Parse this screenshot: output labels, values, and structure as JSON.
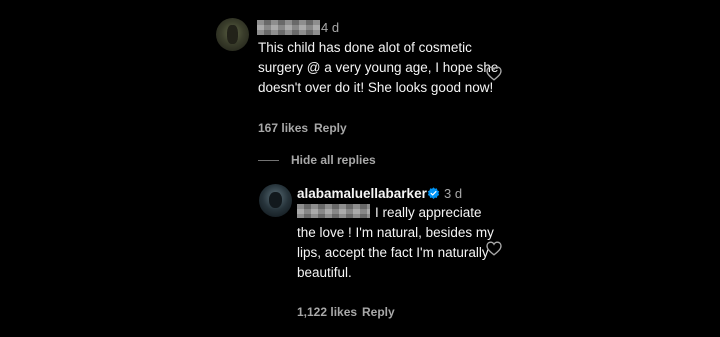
{
  "comment": {
    "time": "4 d",
    "text": "This child has done alot of cosmetic surgery @ a very young age, I hope she doesn't over do it! She looks good now!",
    "likes": "167 likes",
    "reply_label": "Reply"
  },
  "replies_toggle": {
    "label": "Hide all replies"
  },
  "reply": {
    "username": "alabamaluellabarker",
    "verified_icon": "verified-badge-icon",
    "time": "3 d",
    "text": "I really appreciate the love ! I'm natural, besides my lips, accept the fact I'm naturally beautiful.",
    "likes": "1,122 likes",
    "reply_label": "Reply"
  },
  "icons": {
    "like": "heart-icon",
    "verified": "verified-badge-icon"
  },
  "colors": {
    "background": "#000000",
    "primary_text": "#f5f5f5",
    "secondary_text": "#a8a8a8",
    "verified_blue": "#0095f6",
    "redaction_gray": "#8c8c8c"
  }
}
